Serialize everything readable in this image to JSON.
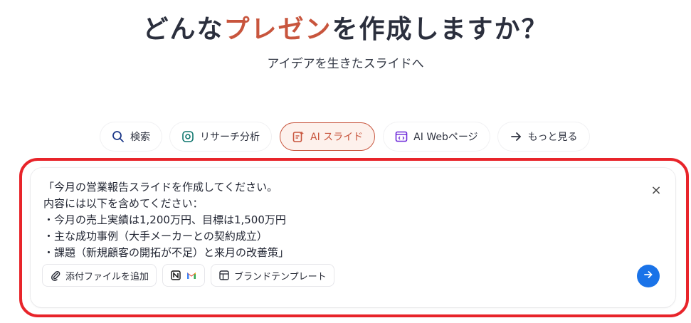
{
  "header": {
    "title_before": "どんな",
    "title_accent": "プレゼン",
    "title_after": "を作成しますか？",
    "subtitle": "アイデアを生きたスライドへ"
  },
  "tabs": [
    {
      "label": "検索",
      "icon": "search-icon"
    },
    {
      "label": "リサーチ分析",
      "icon": "research-icon"
    },
    {
      "label": "AI スライド",
      "icon": "slide-icon",
      "active": true
    },
    {
      "label": "AI Webページ",
      "icon": "webpage-icon"
    },
    {
      "label": "もっと見る",
      "icon": "arrow-right-icon"
    }
  ],
  "prompt": {
    "lines": [
      "「今月の営業報告スライドを作成してください。",
      "内容には以下を含めてください：",
      "・今月の売上実績は1,200万円、目標は1,500万円",
      "・主な成功事例（大手メーカーとの契約成立）",
      "・課題（新規顧客の開拓が不足）と来月の改善策」"
    ],
    "close_symbol": "×"
  },
  "toolbar": {
    "attach_label": "添付ファイルを追加",
    "template_label": "ブランドテンプレート"
  },
  "colors": {
    "accent": "#c8553d",
    "highlight_frame": "#e8242a",
    "send_button": "#1a73e8"
  }
}
